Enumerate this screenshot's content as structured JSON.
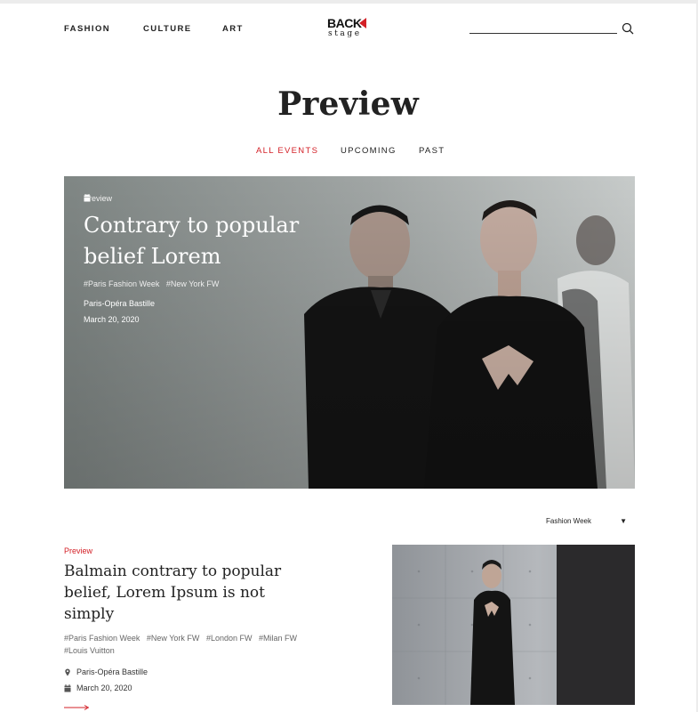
{
  "nav": {
    "links": [
      "FASHION",
      "CULTURE",
      "ART"
    ],
    "logo_top": "BACK",
    "logo_bottom": "stage",
    "accent": "#d32027"
  },
  "page_title": "Preview",
  "filters": [
    "ALL EVENTS",
    "UPCOMING",
    "PAST"
  ],
  "hero": {
    "kicker": "Preview",
    "title": "Contrary to popular belief Lorem",
    "tags": [
      "#Paris Fashion Week",
      "#New York FW"
    ],
    "location": "Paris-Opéra Bastille",
    "date": "March 20, 2020"
  },
  "sort": {
    "selected": "Fashion Week"
  },
  "article": {
    "kicker": "Preview",
    "title": "Balmain contrary to popular belief, Lorem Ipsum is not simply",
    "tags": [
      "#Paris Fashion Week",
      "#New York FW",
      "#London FW",
      "#Milan FW",
      "#Louis Vuitton"
    ],
    "location": "Paris-Opéra Bastille",
    "date": "March 20, 2020"
  }
}
